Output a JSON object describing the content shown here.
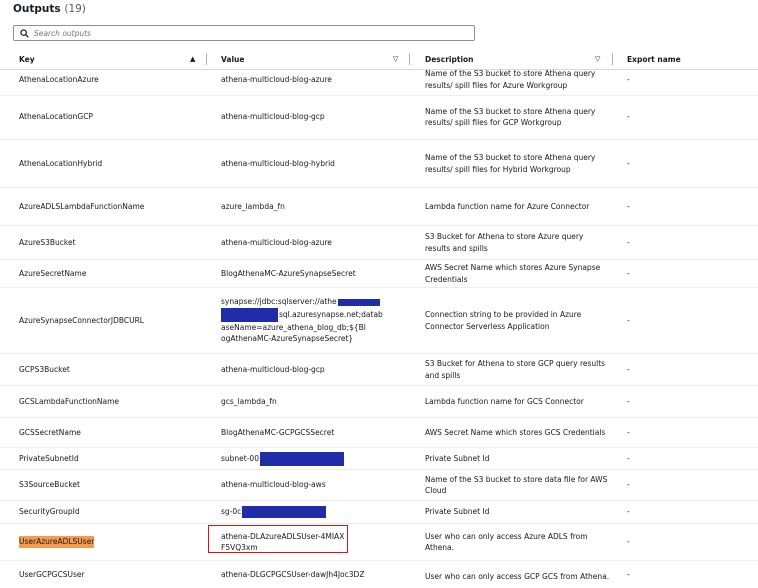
{
  "header": {
    "title": "Outputs",
    "count": "(19)"
  },
  "search": {
    "placeholder": "Search outputs"
  },
  "columns": {
    "key": "Key",
    "value": "Value",
    "description": "Description",
    "export": "Export name"
  },
  "rows": [
    {
      "key": "AthenaLocationAzure",
      "value": "athena-multicloud-blog-azure",
      "description": "Name of the S3 bucket to store Athena query results/ spill files for Azure Workgroup",
      "export": "-"
    },
    {
      "key": "AthenaLocationGCP",
      "value": "athena-multicloud-blog-gcp",
      "description": "Name of the S3 bucket to store Athena query results/ spill files for GCP Workgroup",
      "export": "-"
    },
    {
      "key": "AthenaLocationHybrid",
      "value": "athena-multicloud-blog-hybrid",
      "description": "Name of the S3 bucket to store Athena query results/ spill files for Hybrid Workgroup",
      "export": "-"
    },
    {
      "key": "AzureADLSLambdaFunctionName",
      "value": "azure_lambda_fn",
      "description": "Lambda function name for Azure Connector",
      "export": "-"
    },
    {
      "key": "AzureS3Bucket",
      "value": "athena-multicloud-blog-azure",
      "description": "S3 Bucket for Athena to store Azure query results and spills",
      "export": "-"
    },
    {
      "key": "AzureSecretName",
      "value": "BlogAthenaMC-AzureSynapseSecret",
      "description": "AWS Secret Name which stores Azure Synapse Credentials",
      "export": "-"
    },
    {
      "key": "AzureSynapseConnectorJDBCURL",
      "value_part1": "synapse://jdbc:sqlserver://athe",
      "value_part2": "sql.azuresynapse.net;datab",
      "value_part3": "aseName=azure_athena_blog_db;${Bl",
      "value_part4": "ogAthenaMC-AzureSynapseSecret}",
      "description": "Connection string to be provided in Azure Connector Serverless Application",
      "export": "-"
    },
    {
      "key": "GCPS3Bucket",
      "value": "athena-multicloud-blog-gcp",
      "description": "S3 Bucket for Athena to store GCP query results and spills",
      "export": "-"
    },
    {
      "key": "GCSLambdaFunctionName",
      "value": "gcs_lambda_fn",
      "description": "Lambda function name for GCS Connector",
      "export": "-"
    },
    {
      "key": "GCSSecretName",
      "value": "BlogAthenaMC-GCPGCSSecret",
      "description": "AWS Secret Name which stores GCS Credentials",
      "export": "-"
    },
    {
      "key": "PrivateSubnetId",
      "value": "subnet-00",
      "description": "Private Subnet Id",
      "export": "-"
    },
    {
      "key": "S3SourceBucket",
      "value": "athena-multicloud-blog-aws",
      "description": "Name of the S3 bucket to store data file for AWS Cloud",
      "export": "-"
    },
    {
      "key": "SecurityGroupId",
      "value": "sg-0c",
      "description": "Private Subnet Id",
      "export": "-"
    },
    {
      "key": "UserAzureADLSUser",
      "value": "athena-DLAzureADLSUser-4MIAXF5VQ3xm",
      "description": "User who can only access Azure ADLS from Athena.",
      "export": "-"
    },
    {
      "key": "UserGCPGCSUser",
      "value": "athena-DLGCPGCSUser-dawJh4Joc3DZ",
      "description": "User who can only access GCP GCS from Athena.",
      "export": "-"
    }
  ],
  "colors": {
    "redaction": "#1f2da8",
    "highlight": "#f89b4e",
    "annotation_box": "#d91515"
  }
}
